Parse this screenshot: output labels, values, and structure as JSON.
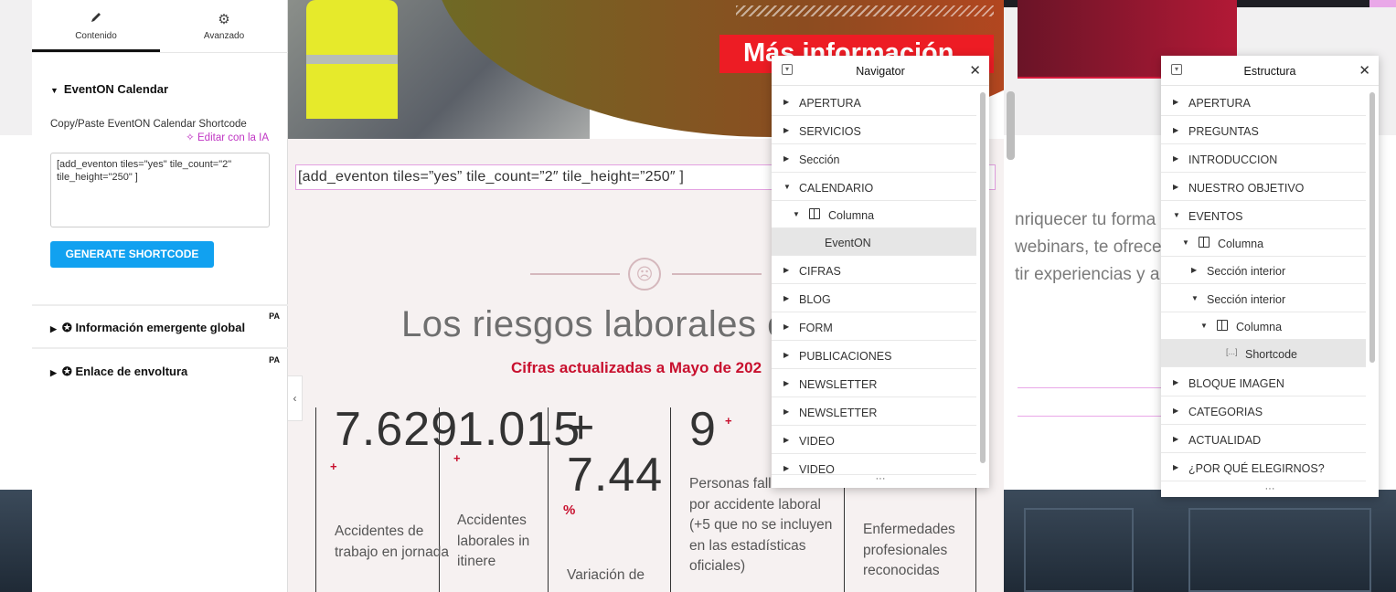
{
  "editor": {
    "tabs": [
      {
        "label": "Contenido",
        "icon": "pencil-icon"
      },
      {
        "label": "Avanzado",
        "icon": "gear-icon"
      }
    ],
    "section_title": "EventON Calendar",
    "field_label": "Copy/Paste EventON Calendar Shortcode",
    "ai_link": "✧ Editar con la IA",
    "shortcode_value": "[add_eventon tiles=\"yes\" tile_count=\"2\" tile_height=\"250\" ]",
    "generate_button": "GENERATE SHORTCODE",
    "sections": [
      {
        "label": "Información emergente global",
        "badge": "PA"
      },
      {
        "label": "Enlace de envoltura",
        "badge": "PA"
      }
    ]
  },
  "preview": {
    "hero_button": "Más información",
    "shortcode_display": "[add_eventon tiles=”yes” tile_count=”2″ tile_height=”250″ ]",
    "risk_title": "Los riesgos laborales e",
    "risk_subtitle": "Cifras actualizadas a Mayo de 202",
    "stats": [
      {
        "number": "7.629",
        "plus": "+",
        "label": "Accidentes de trabajo en jornada"
      },
      {
        "number": "1.015",
        "plus": "+",
        "label": "Accidentes laborales in itinere"
      },
      {
        "number": "+ 7.44",
        "plus": "%",
        "label": "Variación de"
      },
      {
        "number": "9",
        "plus": "+",
        "label": "Personas fallecidas por accidente laboral (+5 que no se incluyen en las estadísticas oficiales)"
      },
      {
        "number": "",
        "plus": "",
        "label": "Enfermedades profesionales reconocidas"
      }
    ],
    "background_lines": [
      "nriquecer tu forma",
      "webinars, te ofrece",
      "tir experiencias y a"
    ]
  },
  "navigator": {
    "title": "Navigator",
    "items": [
      "APERTURA",
      "SERVICIOS",
      "Sección",
      "CALENDARIO",
      "Columna",
      "EventON",
      "CIFRAS",
      "BLOG",
      "FORM",
      "PUBLICACIONES",
      "NEWSLETTER",
      "NEWSLETTER",
      "VIDEO",
      "VIDEO"
    ],
    "more": "···"
  },
  "estructura": {
    "title": "Estructura",
    "items": [
      "APERTURA",
      "PREGUNTAS",
      "INTRODUCCION",
      "NUESTRO OBJETIVO",
      "EVENTOS",
      "Columna",
      "Sección interior",
      "Sección interior",
      "Columna",
      "Shortcode",
      "BLOQUE IMAGEN",
      "CATEGORIAS",
      "ACTUALIDAD",
      "¿POR QUÉ ELEGIRNOS?"
    ],
    "more": "···"
  },
  "colors": {
    "accent_blue": "#11a1f0",
    "ai_purple": "#c036c4",
    "brand_red": "#ed1c24",
    "subtitle_red": "#c8102e"
  }
}
